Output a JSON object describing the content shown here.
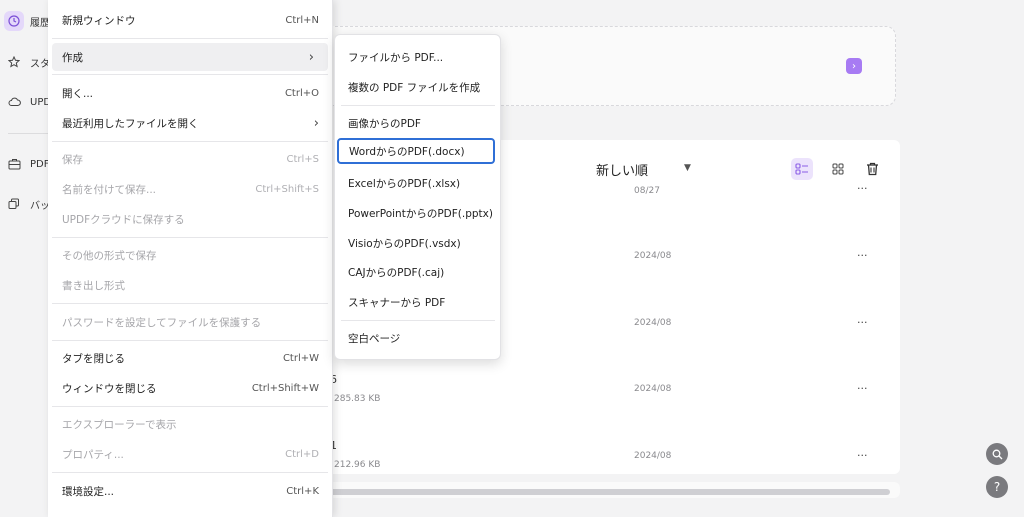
{
  "sidebar": {
    "items": [
      {
        "label": "履歴",
        "icon": "clock-icon"
      },
      {
        "label": "スター",
        "icon": "star-icon"
      },
      {
        "label": "UPDF",
        "icon": "cloud-icon"
      },
      {
        "label": "PDF",
        "icon": "briefcase-icon"
      },
      {
        "label": "バッチ",
        "icon": "copy-icon"
      }
    ]
  },
  "file_menu": {
    "new_window": {
      "label": "新規ウィンドウ",
      "shortcut": "Ctrl+N"
    },
    "create": {
      "label": "作成"
    },
    "open": {
      "label": "開く...",
      "shortcut": "Ctrl+O"
    },
    "recent": {
      "label": "最近利用したファイルを開く"
    },
    "save": {
      "label": "保存",
      "shortcut": "Ctrl+S"
    },
    "save_as": {
      "label": "名前を付けて保存...",
      "shortcut": "Ctrl+Shift+S"
    },
    "save_cloud": {
      "label": "UPDFクラウドに保存する"
    },
    "save_other": {
      "label": "その他の形式で保存"
    },
    "export": {
      "label": "書き出し形式"
    },
    "protect": {
      "label": "パスワードを設定してファイルを保護する"
    },
    "close_tab": {
      "label": "タブを閉じる",
      "shortcut": "Ctrl+W"
    },
    "close_window": {
      "label": "ウィンドウを閉じる",
      "shortcut": "Ctrl+Shift+W"
    },
    "explorer": {
      "label": "エクスプローラーで表示"
    },
    "properties": {
      "label": "プロパティ...",
      "shortcut": "Ctrl+D"
    },
    "preferences": {
      "label": "環境設定...",
      "shortcut": "Ctrl+K"
    }
  },
  "create_submenu": {
    "from_file": "ファイルから PDF...",
    "multiple": "複数の PDF ファイルを作成",
    "from_image": "画像からのPDF",
    "from_word": "WordからのPDF(.docx)",
    "from_excel": "ExcelからのPDF(.xlsx)",
    "from_ppt": "PowerPointからのPDF(.pptx)",
    "from_visio": "VisioからのPDF(.vsdx)",
    "from_caj": "CAJからのPDF(.caj)",
    "from_scanner": "スキャナーから PDF",
    "blank": "空白ページ"
  },
  "main": {
    "sort_label": "新しい順",
    "rows": [
      {
        "date": "08/27"
      },
      {
        "date": "2024/08"
      },
      {
        "date": "2024/08"
      },
      {
        "name": "6",
        "size": "285.83 KB",
        "date": "2024/08"
      },
      {
        "name": "1",
        "size": "212.96 KB",
        "date": "2024/08"
      }
    ],
    "more_glyph": "···",
    "upload_arrow": "›"
  },
  "float": {
    "search_glyph": "⌕",
    "help_glyph": "?"
  },
  "colors": {
    "accent": "#a77bf3",
    "selection_outline": "#2f6fd6"
  }
}
